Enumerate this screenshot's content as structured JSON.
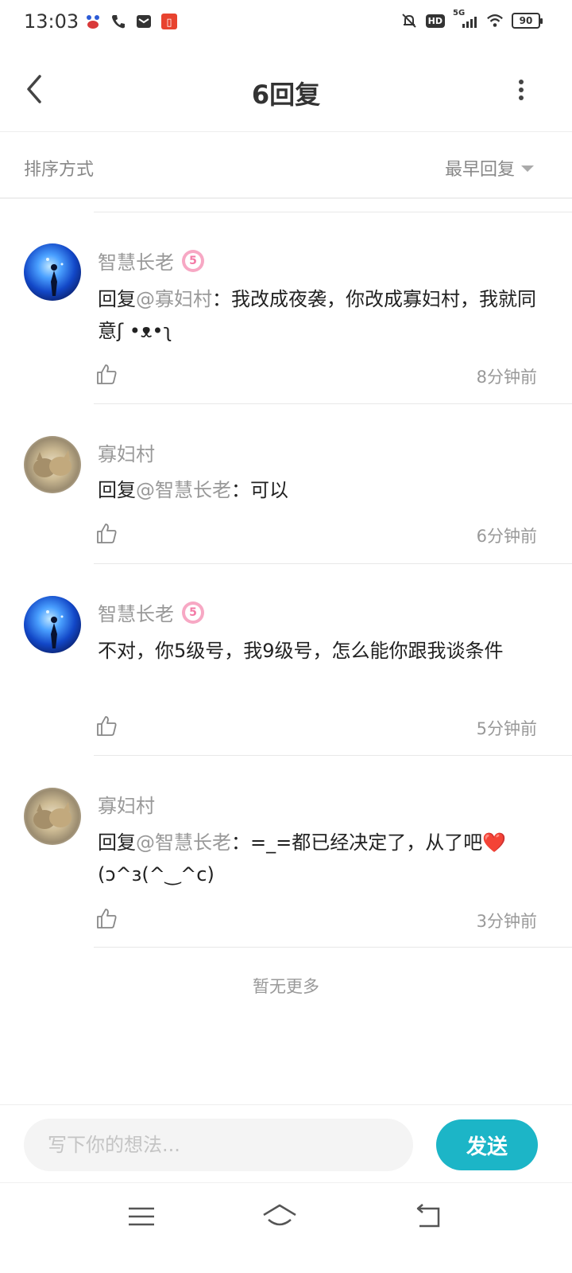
{
  "status_bar": {
    "time": "13:03",
    "network": "5G",
    "hd": "HD",
    "battery": "90",
    "icons": [
      "baidu-app-icon",
      "phone-icon",
      "mail-icon",
      "listen-app-icon",
      "mute-bell-icon",
      "hd-icon",
      "signal-icon",
      "wifi-icon",
      "battery-icon"
    ]
  },
  "header": {
    "title": "6回复",
    "back_icon": "chevron-left-icon",
    "more_icon": "more-vertical-icon"
  },
  "sort": {
    "label": "排序方式",
    "selected": "最早回复"
  },
  "replies": [
    {
      "user": "智慧长老",
      "level": "5",
      "prefix": "回复",
      "mention": "@寡妇村",
      "text": "：我改成夜袭，你改成寡妇村，我就同意ʃ •ᴥ•ʅ",
      "time": "8分钟前"
    },
    {
      "user": "寡妇村",
      "prefix": "回复",
      "mention": "@智慧长老",
      "text": "：可以",
      "time": "6分钟前"
    },
    {
      "user": "智慧长老",
      "level": "5",
      "text": "不对，你5级号，我9级号，怎么能你跟我谈条件",
      "time": "5分钟前"
    },
    {
      "user": "寡妇村",
      "prefix": "回复",
      "mention": "@智慧长老",
      "text": "：=_=都已经决定了，从了吧❤️ (ɔ^з(^‿^c)",
      "time": "3分钟前"
    }
  ],
  "footer_note": "暂无更多",
  "input": {
    "placeholder": "写下你的想法...",
    "send_label": "发送"
  },
  "colors": {
    "accent": "#1cb5c7",
    "muted_text": "#999999",
    "level_badge": "#f7a8c4"
  },
  "nav": [
    "menu-icon",
    "home-icon",
    "back-arrow-icon"
  ]
}
